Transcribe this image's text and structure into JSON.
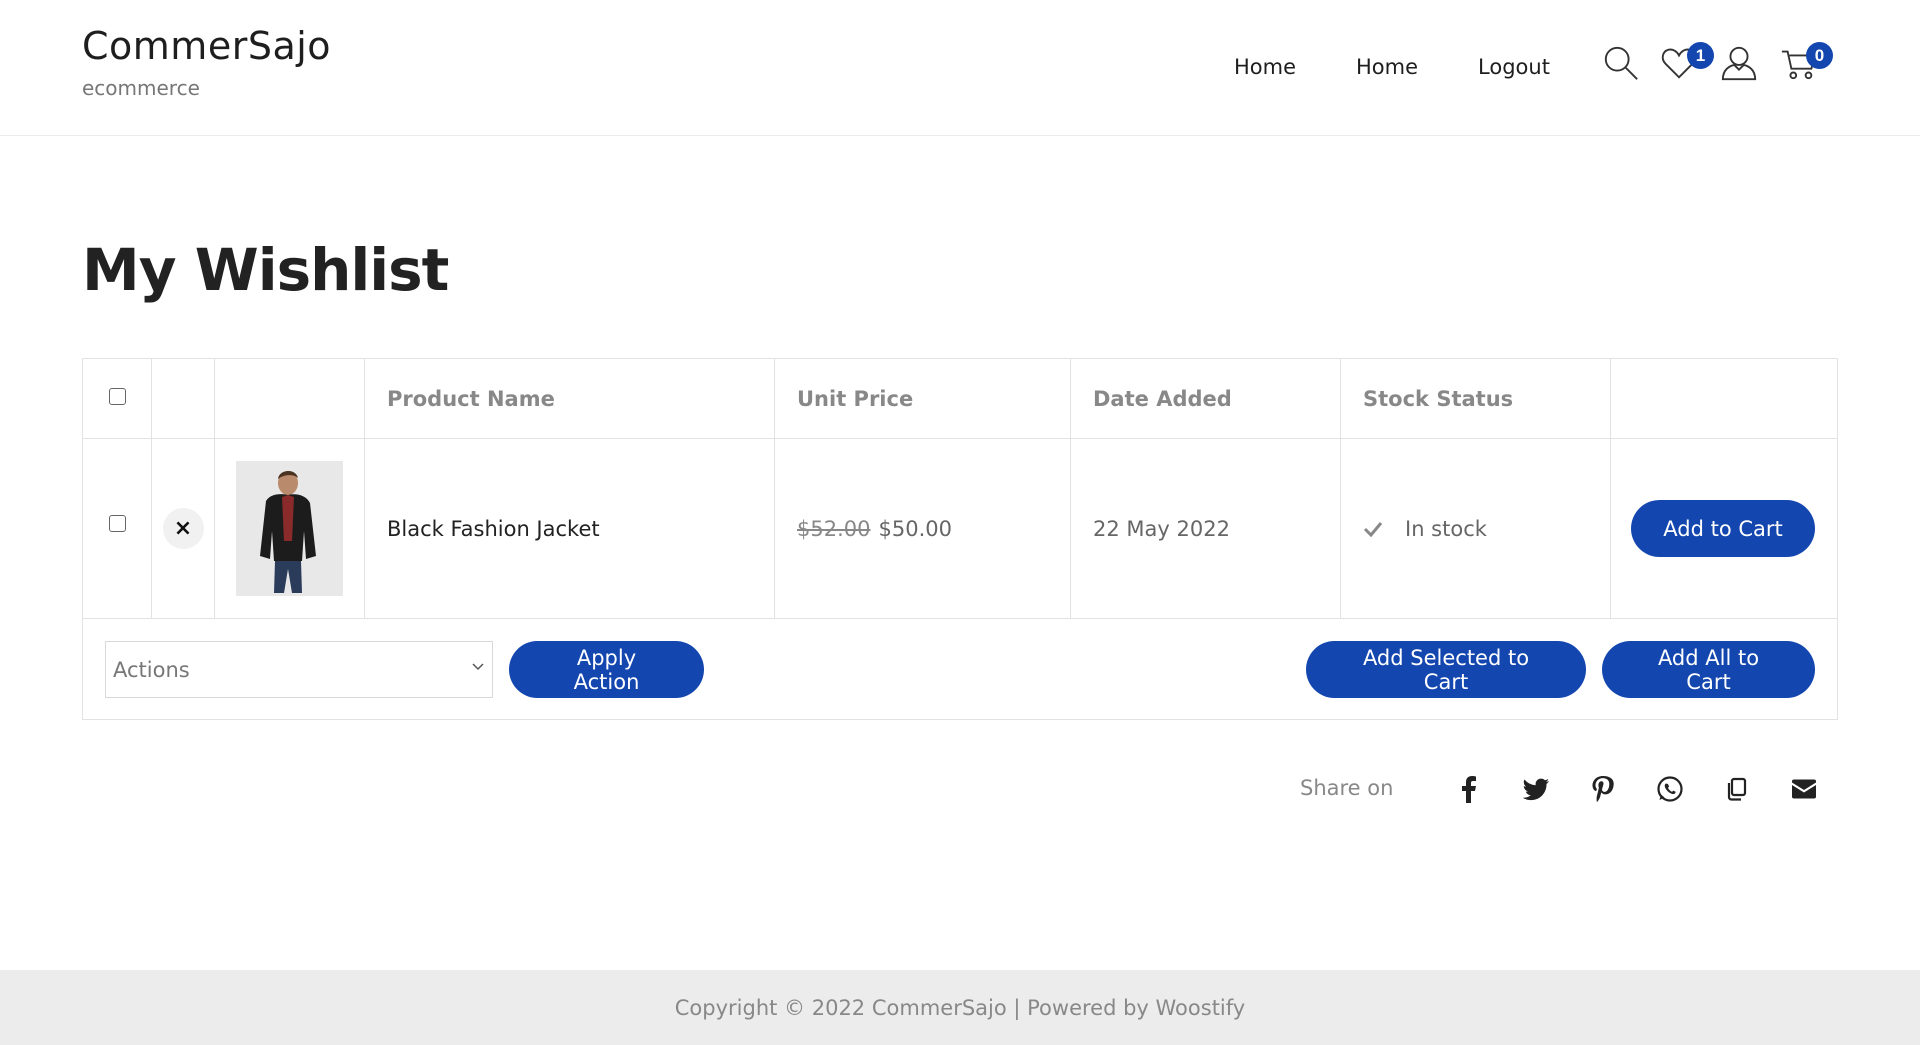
{
  "header": {
    "site_title": "CommerSajo",
    "tagline": "ecommerce",
    "nav": [
      {
        "label": "Home"
      },
      {
        "label": "Home"
      },
      {
        "label": "Logout"
      }
    ],
    "icons": {
      "search": "search-icon",
      "wishlist": "heart-icon",
      "account": "user-icon",
      "cart": "cart-icon"
    },
    "wishlist_count": "1",
    "cart_count": "0"
  },
  "page": {
    "title": "My Wishlist"
  },
  "table": {
    "columns": [
      "",
      "",
      "",
      "Product Name",
      "Unit Price",
      "Date Added",
      "Stock Status",
      ""
    ],
    "rows": [
      {
        "remove_symbol": "×",
        "product_name": "Black Fashion Jacket",
        "old_price": "$52.00",
        "price": "$50.00",
        "date_added": "22 May 2022",
        "stock_status": "In stock",
        "add_to_cart_label": "Add to Cart"
      }
    ],
    "actions_select": {
      "selected": "Actions"
    },
    "apply_action_label": "Apply Action",
    "add_selected_label": "Add Selected to Cart",
    "add_all_label": "Add All to Cart"
  },
  "share": {
    "label": "Share on",
    "icons": [
      "facebook-icon",
      "twitter-icon",
      "pinterest-icon",
      "whatsapp-icon",
      "copy-icon",
      "email-icon"
    ]
  },
  "footer": {
    "copyright": "Copyright © 2022 CommerSajo | Powered by Woostify"
  },
  "colors": {
    "accent": "#1346af",
    "border": "#e2e2e2",
    "footer_bg": "#ececec",
    "muted_text": "#888888"
  }
}
